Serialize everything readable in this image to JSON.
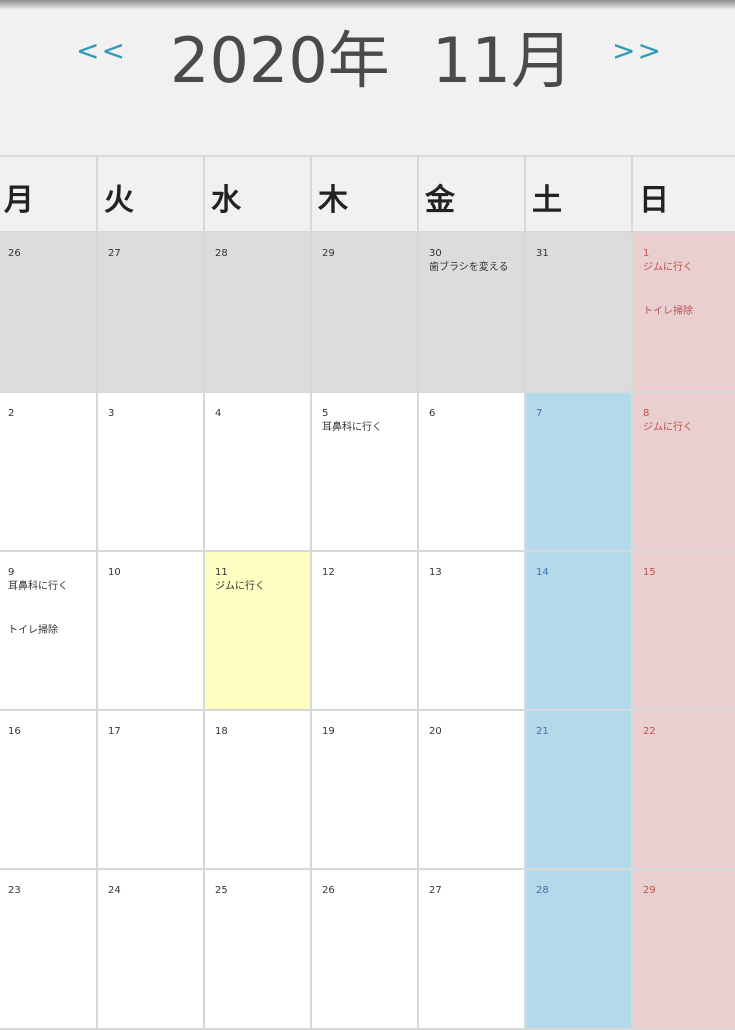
{
  "header": {
    "prev_label": "<<",
    "next_label": ">>",
    "year_label": "2020年",
    "month_label": "11月"
  },
  "weekdays": [
    "月",
    "火",
    "水",
    "木",
    "金",
    "土",
    "日"
  ],
  "weeks": [
    [
      {
        "day": "26",
        "events": []
      },
      {
        "day": "27",
        "events": []
      },
      {
        "day": "28",
        "events": []
      },
      {
        "day": "29",
        "events": []
      },
      {
        "day": "30",
        "events": [
          "歯ブラシを変える"
        ]
      },
      {
        "day": "31",
        "events": []
      },
      {
        "day": "1",
        "events": [
          "ジムに行く",
          "トイレ掃除"
        ]
      }
    ],
    [
      {
        "day": "2",
        "events": []
      },
      {
        "day": "3",
        "events": []
      },
      {
        "day": "4",
        "events": []
      },
      {
        "day": "5",
        "events": [
          "耳鼻科に行く"
        ]
      },
      {
        "day": "6",
        "events": []
      },
      {
        "day": "7",
        "events": []
      },
      {
        "day": "8",
        "events": [
          "ジムに行く"
        ]
      }
    ],
    [
      {
        "day": "9",
        "events": [
          "耳鼻科に行く",
          "トイレ掃除"
        ]
      },
      {
        "day": "10",
        "events": []
      },
      {
        "day": "11",
        "events": [
          "ジムに行く"
        ]
      },
      {
        "day": "12",
        "events": []
      },
      {
        "day": "13",
        "events": []
      },
      {
        "day": "14",
        "events": []
      },
      {
        "day": "15",
        "events": []
      }
    ],
    [
      {
        "day": "16",
        "events": []
      },
      {
        "day": "17",
        "events": []
      },
      {
        "day": "18",
        "events": []
      },
      {
        "day": "19",
        "events": []
      },
      {
        "day": "20",
        "events": []
      },
      {
        "day": "21",
        "events": []
      },
      {
        "day": "22",
        "events": []
      }
    ],
    [
      {
        "day": "23",
        "events": []
      },
      {
        "day": "24",
        "events": []
      },
      {
        "day": "25",
        "events": []
      },
      {
        "day": "26",
        "events": []
      },
      {
        "day": "27",
        "events": []
      },
      {
        "day": "28",
        "events": []
      },
      {
        "day": "29",
        "events": []
      }
    ]
  ],
  "colors": {
    "nav_accent": "#2c9bb3",
    "previous_month_bg": "#dcdcdc",
    "saturday_bg": "#b3d9ea",
    "sunday_bg": "#eacfd0",
    "today_bg": "#fefec3",
    "sunday_text": "#c0504d",
    "saturday_text": "#3f72b0"
  }
}
